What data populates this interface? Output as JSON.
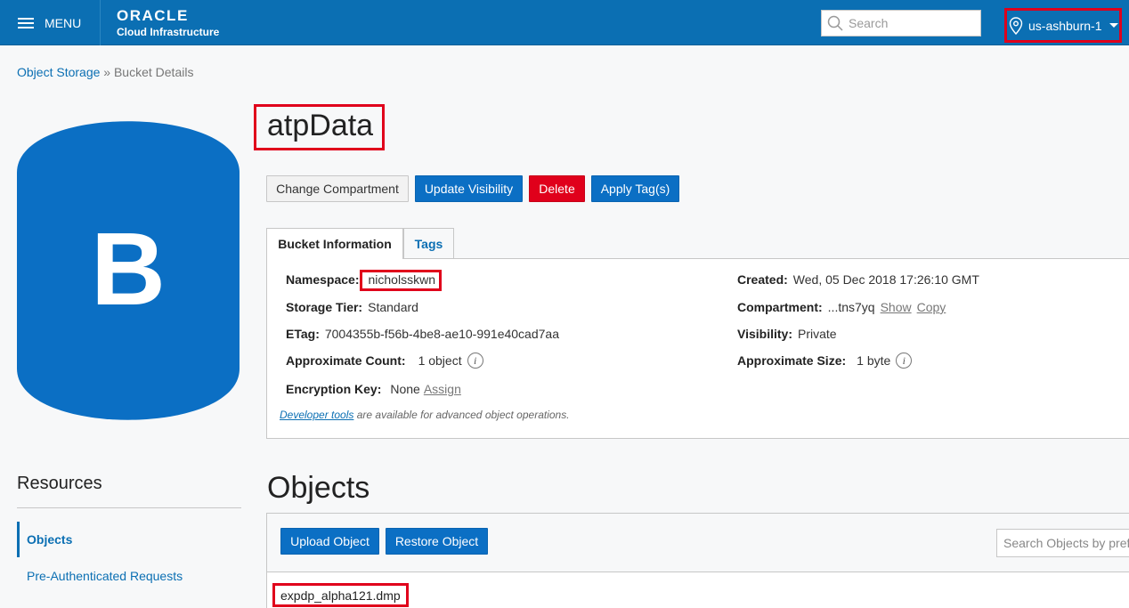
{
  "header": {
    "menu_label": "MENU",
    "brand_line1": "ORACLE",
    "brand_line2": "Cloud Infrastructure",
    "search_placeholder": "Search",
    "region": "us-ashburn-1"
  },
  "breadcrumb": {
    "parent": "Object Storage",
    "separator": "»",
    "current": "Bucket Details"
  },
  "bucket": {
    "icon_letter": "B",
    "name": "atpData",
    "icon_color": "#0b6fc4"
  },
  "actions": {
    "change_compartment": "Change Compartment",
    "update_visibility": "Update Visibility",
    "delete": "Delete",
    "apply_tags": "Apply Tag(s)"
  },
  "tabs": {
    "bucket_information": "Bucket Information",
    "tags": "Tags"
  },
  "info": {
    "namespace_label": "Namespace:",
    "namespace_value": "nicholsskwn",
    "storage_tier_label": "Storage Tier:",
    "storage_tier_value": "Standard",
    "etag_label": "ETag:",
    "etag_value": "7004355b-f56b-4be8-ae10-991e40cad7aa",
    "approx_count_label": "Approximate Count:",
    "approx_count_value": "1 object",
    "encryption_key_label": "Encryption Key:",
    "encryption_key_value": "None",
    "encryption_key_action": "Assign",
    "created_label": "Created:",
    "created_value": "Wed, 05 Dec 2018 17:26:10 GMT",
    "compartment_label": "Compartment:",
    "compartment_value": "...tns7yq",
    "compartment_show": "Show",
    "compartment_copy": "Copy",
    "visibility_label": "Visibility:",
    "visibility_value": "Private",
    "approx_size_label": "Approximate Size:",
    "approx_size_value": "1 byte",
    "dev_tools_link": "Developer tools",
    "dev_tools_text": " are available for advanced object operations."
  },
  "resources": {
    "title": "Resources",
    "items": [
      {
        "label": "Objects"
      },
      {
        "label": "Pre-Authenticated Requests"
      }
    ]
  },
  "objects": {
    "title": "Objects",
    "upload_button": "Upload Object",
    "restore_button": "Restore Object",
    "search_placeholder": "Search Objects by prefix",
    "rows": [
      {
        "name": "expdp_alpha121.dmp"
      }
    ]
  },
  "colors": {
    "header_bg": "#0b6fb3",
    "primary": "#0b6fc4",
    "danger": "#e0001b",
    "highlight": "#e0001b"
  }
}
